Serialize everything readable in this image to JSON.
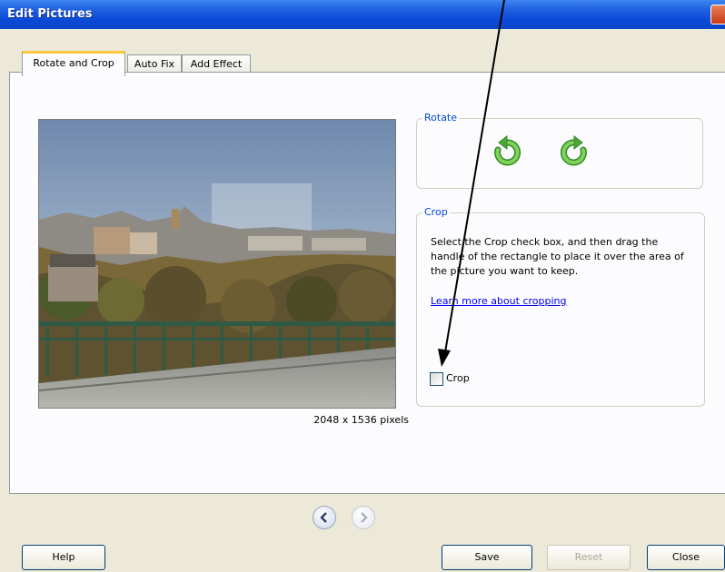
{
  "window": {
    "title": "Edit Pictures"
  },
  "tabs": [
    {
      "label": "Rotate and Crop",
      "active": true
    },
    {
      "label": "Auto Fix",
      "active": false
    },
    {
      "label": "Add Effect",
      "active": false
    }
  ],
  "preview": {
    "caption": "2048 x 1536 pixels"
  },
  "rotate": {
    "group_label": "Rotate",
    "left_icon": "rotate-left-icon",
    "right_icon": "rotate-right-icon"
  },
  "crop": {
    "group_label": "Crop",
    "instructions": "Select the Crop check box, and then drag the handle of the rectangle to place it over the area of the picture you want to keep.",
    "learn_more_link": "Learn more about cropping",
    "checkbox_label": "Crop",
    "checked": false
  },
  "navigation": {
    "prev_icon": "chevron-left-icon",
    "next_icon": "chevron-right-icon"
  },
  "buttons": {
    "help": "Help",
    "save": "Save",
    "reset": "Reset",
    "close": "Close"
  },
  "colors": {
    "title_bar": "#0a49d6",
    "group_label": "#0046d5",
    "rotate_arrow": "#58b83a",
    "link": "#0000ee"
  }
}
